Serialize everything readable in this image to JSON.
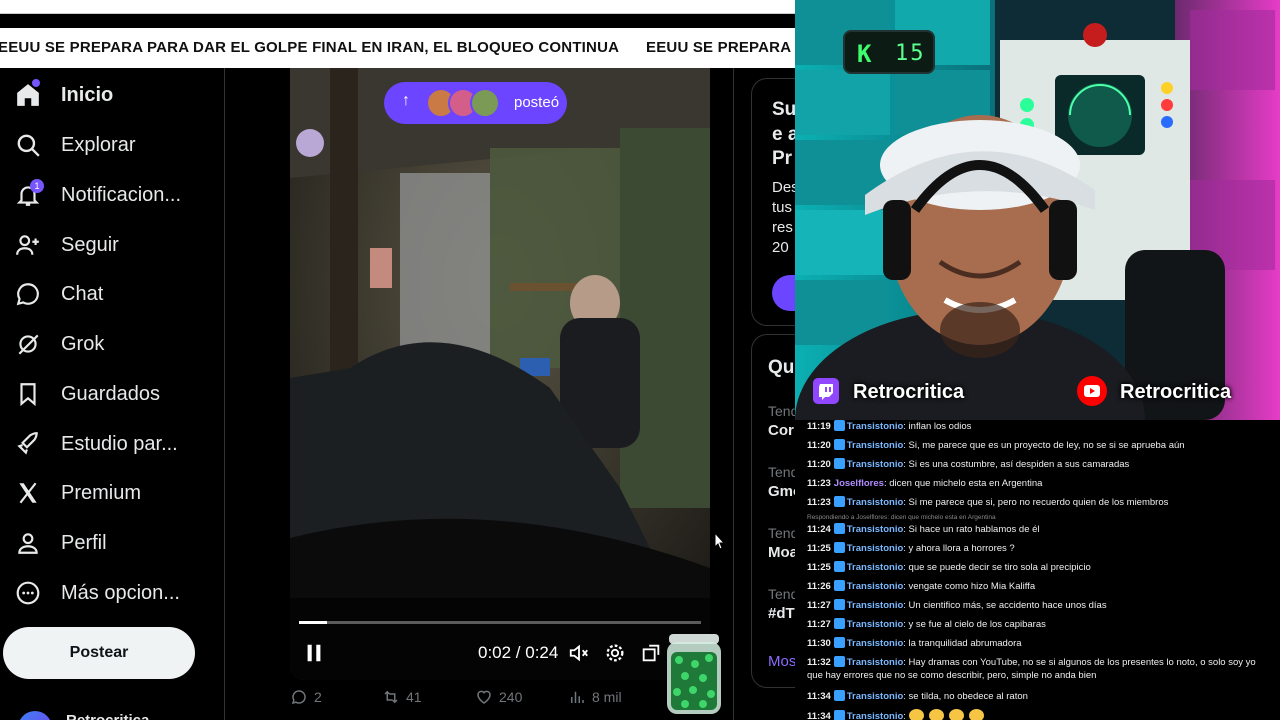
{
  "ticker": {
    "headline_1": "EEUU SE PREPARA PARA DAR EL GOLPE FINAL EN IRAN, EL BLOQUEO CONTINUA",
    "headline_2": "EEUU SE PREPARA PA"
  },
  "sidebar": {
    "items": [
      {
        "label": "Inicio",
        "icon": "home-icon"
      },
      {
        "label": "Explorar",
        "icon": "search-icon"
      },
      {
        "label": "Notificacion...",
        "icon": "bell-icon",
        "badge": "1"
      },
      {
        "label": "Seguir",
        "icon": "person-add-icon"
      },
      {
        "label": "Chat",
        "icon": "chat-bubble-icon"
      },
      {
        "label": "Grok",
        "icon": "grok-icon"
      },
      {
        "label": "Guardados",
        "icon": "bookmark-icon"
      },
      {
        "label": "Estudio par...",
        "icon": "rocket-icon"
      },
      {
        "label": "Premium",
        "icon": "x-logo-icon"
      },
      {
        "label": "Perfil",
        "icon": "person-icon"
      },
      {
        "label": "Más opcion...",
        "icon": "more-circle-icon"
      }
    ],
    "post_button": "Postear",
    "profile_name": "Retrocritica"
  },
  "video": {
    "posted_pill": "posteó",
    "time": "0:02 / 0:24",
    "progress": 0.07
  },
  "stats": {
    "replies": "2",
    "reposts": "41",
    "likes": "240",
    "views": "8 mil"
  },
  "right_column": {
    "card1_lines": [
      "Su",
      "e a",
      "Pr"
    ],
    "card1_body": [
      "Des",
      "tus",
      "res",
      "20"
    ],
    "trends_title": "Qu",
    "trends": [
      {
        "context": "Tend",
        "name": "Cor"
      },
      {
        "context": "Tend",
        "name": "Gmo"
      },
      {
        "context": "Tend",
        "name": "Moa"
      },
      {
        "context": "Tend",
        "name": "#dT"
      }
    ],
    "show_more": "Mos"
  },
  "stream": {
    "counter": "15",
    "twitch_name": "Retrocritica",
    "youtube_name": "Retrocritica"
  },
  "chat": [
    {
      "time": "11:19",
      "user": "Transistonio",
      "text": "inflan los odios"
    },
    {
      "time": "11:20",
      "user": "Transistonio",
      "text": "Si, me parece que es un proyecto de ley, no se si se aprueba aún"
    },
    {
      "time": "11:20",
      "user": "Transistonio",
      "text": "Si es una costumbre, así despiden a sus camaradas"
    },
    {
      "time": "11:23",
      "user": "Joselflores",
      "text": "dicen que michelo esta en Argentina"
    },
    {
      "time": "11:23",
      "user": "Transistonio",
      "text": "Si me parece que si, pero no recuerdo quien de los miembros"
    },
    {
      "time": "11:24",
      "user": "Transistonio",
      "text": "Si hace un rato hablamos de él"
    },
    {
      "time": "11:25",
      "user": "Transistonio",
      "text": "y ahora llora a horrores ?"
    },
    {
      "time": "11:25",
      "user": "Transistonio",
      "text": "que se puede decir se tiro sola al precipicio"
    },
    {
      "time": "11:26",
      "user": "Transistonio",
      "text": "vengate como hizo Mia Kaliffa"
    },
    {
      "time": "11:27",
      "user": "Transistonio",
      "text": "Un cientifico más, se accidento hace unos días"
    },
    {
      "time": "11:27",
      "user": "Transistonio",
      "text": "y se fue al cielo de los capibaras"
    },
    {
      "time": "11:30",
      "user": "Transistonio",
      "text": "la tranquilidad abrumadora"
    },
    {
      "time": "11:32",
      "user": "Transistonio",
      "text": "Hay dramas con YouTube, no se si algunos de los presentes lo noto, o solo soy yo que hay errores que no se como describir, pero, simple no anda bien"
    },
    {
      "time": "11:34",
      "user": "Transistonio",
      "text": "se tilda, no obedece al raton"
    },
    {
      "time": "11:34",
      "user": "Transistonio",
      "text": ""
    }
  ],
  "chat_reply_note": "Respondiendo a Joselflores: dicen que michelo esta en Argentina",
  "colors": {
    "accent": "#7856ff",
    "twitch": "#9146ff",
    "youtube": "#ff0000",
    "chat_user": "#7ab8ff"
  }
}
